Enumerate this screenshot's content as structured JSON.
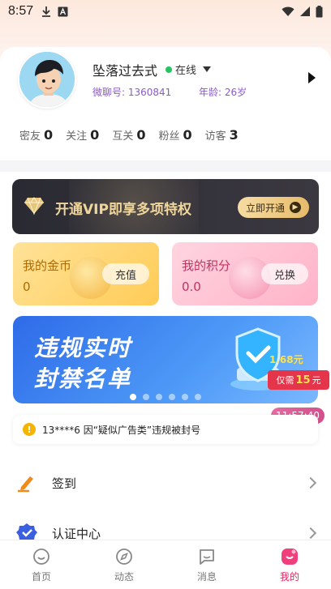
{
  "status": {
    "time": "8:57"
  },
  "profile": {
    "nickname": "坠落过去式",
    "online_label": "在线",
    "id_label": "微聊号: 1360841",
    "age_label": "年龄: 26岁",
    "stats": [
      {
        "label": "密友",
        "value": "0"
      },
      {
        "label": "关注",
        "value": "0"
      },
      {
        "label": "互关",
        "value": "0"
      },
      {
        "label": "粉丝",
        "value": "0"
      },
      {
        "label": "访客",
        "value": "3"
      }
    ]
  },
  "vip": {
    "text": "开通VIP即享多项特权",
    "button": "立即开通"
  },
  "coins": {
    "title": "我的金币",
    "value": "0",
    "button": "充值"
  },
  "points": {
    "title": "我的积分",
    "value": "0.0",
    "button": "兑换"
  },
  "banner": {
    "line1": "违规实时",
    "line2": "封禁名单",
    "dots_count": 6,
    "active_dot": 0
  },
  "promo": {
    "line1": "1.68元",
    "pre": "仅需",
    "amount": "15",
    "post": "元"
  },
  "timer": "11:57:40",
  "notice": "13****6 因“疑似广告类”违规被封号",
  "menu": [
    {
      "label": "签到",
      "icon": "pencil-icon"
    },
    {
      "label": "认证中心",
      "icon": "badge-check-icon"
    }
  ],
  "tabs": [
    {
      "label": "首页",
      "icon": "home-smile-icon",
      "active": false
    },
    {
      "label": "动态",
      "icon": "compass-icon",
      "active": false
    },
    {
      "label": "消息",
      "icon": "chat-icon",
      "active": false
    },
    {
      "label": "我的",
      "icon": "profile-icon",
      "active": true
    }
  ],
  "colors": {
    "accent": "#e0245e",
    "vip_gold": "#f0d69a",
    "online": "#22c55e",
    "id_purple": "#8a5cc6"
  }
}
